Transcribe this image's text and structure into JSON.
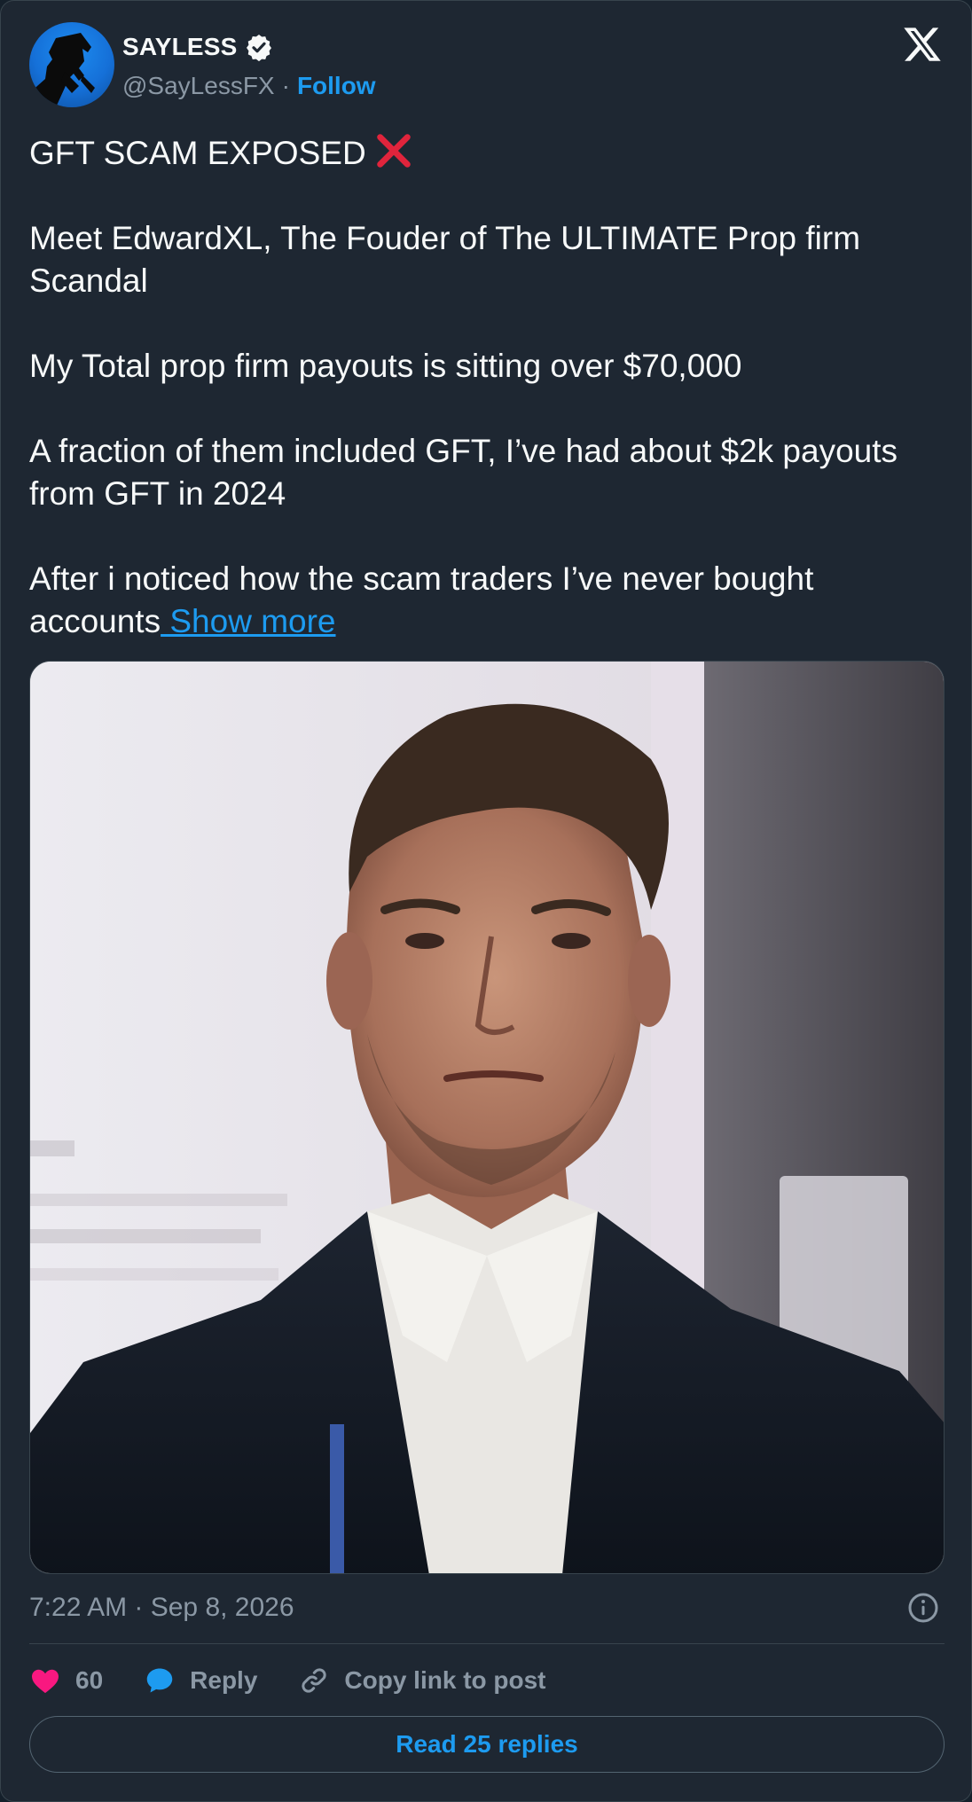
{
  "author": {
    "display_name": "SAYLESS",
    "handle": "@SayLessFX",
    "separator": "·",
    "follow_label": "Follow",
    "verified": true
  },
  "tweet": {
    "line1": "GFT SCAM EXPOSED",
    "line1_emoji": "cross-mark-icon",
    "para2": "Meet EdwardXL, The Fouder of The ULTIMATE Prop firm Scandal",
    "para3": "My Total prop firm payouts is sitting over $70,000",
    "para4": "A fraction of them included GFT, I’ve had about $2k payouts from GFT in 2024",
    "para5": "After i noticed how the scam traders I’ve never bought accounts",
    "show_more": " Show more"
  },
  "media": {
    "type": "photo",
    "subject": "man-in-suit-portrait"
  },
  "meta": {
    "timestamp": "7:22 AM · Sep 8, 2026"
  },
  "actions": {
    "like_count": "60",
    "reply_label": "Reply",
    "copy_link_label": "Copy link to post",
    "read_replies_label": "Read 25 replies"
  },
  "colors": {
    "background": "#1e2732",
    "accent": "#1d9bf0",
    "like": "#f91880",
    "muted": "#8b98a5",
    "text": "#f7f9f9"
  }
}
